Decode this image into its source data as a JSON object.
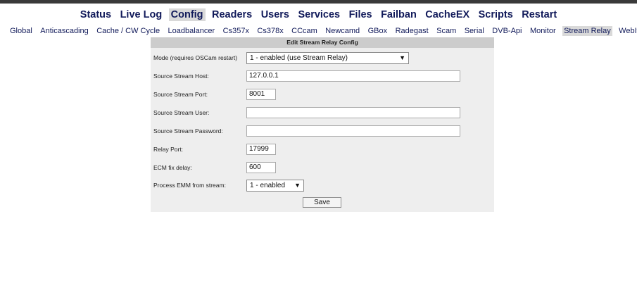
{
  "main_menu": [
    {
      "label": "Status"
    },
    {
      "label": "Live Log"
    },
    {
      "label": "Config",
      "active": true
    },
    {
      "label": "Readers"
    },
    {
      "label": "Users"
    },
    {
      "label": "Services"
    },
    {
      "label": "Files"
    },
    {
      "label": "Failban"
    },
    {
      "label": "CacheEX"
    },
    {
      "label": "Scripts"
    },
    {
      "label": "Restart"
    }
  ],
  "sub_menu": [
    {
      "label": "Global"
    },
    {
      "label": "Anticascading"
    },
    {
      "label": "Cache / CW Cycle"
    },
    {
      "label": "Loadbalancer"
    },
    {
      "label": "Cs357x"
    },
    {
      "label": "Cs378x"
    },
    {
      "label": "CCcam"
    },
    {
      "label": "Newcamd"
    },
    {
      "label": "GBox"
    },
    {
      "label": "Radegast"
    },
    {
      "label": "Scam"
    },
    {
      "label": "Serial"
    },
    {
      "label": "DVB-Api"
    },
    {
      "label": "Monitor"
    },
    {
      "label": "Stream Relay",
      "active": true
    },
    {
      "label": "WebIf"
    }
  ],
  "form": {
    "title": "Edit Stream Relay Config",
    "mode": {
      "label": "Mode (requires OSCam restart)",
      "value": "1 - enabled (use Stream Relay)"
    },
    "host": {
      "label": "Source Stream Host:",
      "value": "127.0.0.1"
    },
    "port": {
      "label": "Source Stream Port:",
      "value": "8001"
    },
    "user": {
      "label": "Source Stream User:",
      "value": ""
    },
    "password": {
      "label": "Source Stream Password:",
      "value": ""
    },
    "relay_port": {
      "label": "Relay Port:",
      "value": "17999"
    },
    "ecm_delay": {
      "label": "ECM fix delay:",
      "value": "600"
    },
    "emm": {
      "label": "Process EMM from stream:",
      "value": "1 - enabled"
    },
    "save_label": "Save"
  }
}
